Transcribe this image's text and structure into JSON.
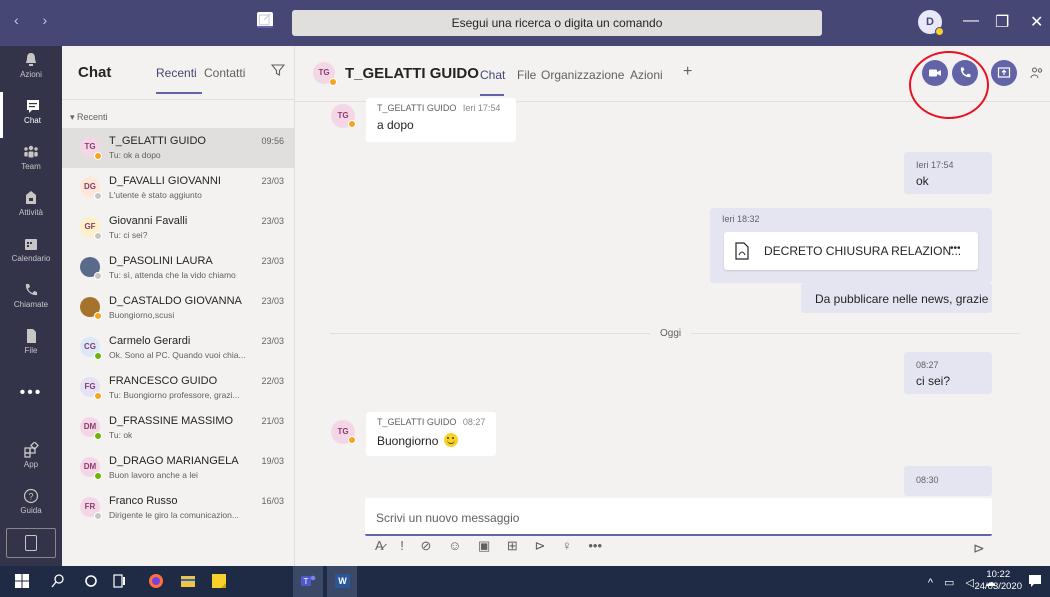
{
  "titlebar": {
    "nav": "‹ ›",
    "search_placeholder": "Esegui una ricerca o digita un comando",
    "profile_initial": "D",
    "minimize": "—",
    "maximize": "❐",
    "close": "✕"
  },
  "rail": [
    {
      "label": "Azioni",
      "icon": "bell-icon"
    },
    {
      "label": "Chat",
      "icon": "chat-icon",
      "active": true
    },
    {
      "label": "Team",
      "icon": "team-icon"
    },
    {
      "label": "Attività",
      "icon": "briefcase-icon"
    },
    {
      "label": "Calendario",
      "icon": "calendar-icon"
    },
    {
      "label": "Chiamate",
      "icon": "phone-icon"
    },
    {
      "label": "File",
      "icon": "file-icon"
    },
    {
      "label": "App",
      "icon": "apps-icon"
    },
    {
      "label": "Guida",
      "icon": "help-icon"
    }
  ],
  "rail_more": "•••",
  "chatlist": {
    "title": "Chat",
    "tab_recent": "Recenti",
    "tab_contacts": "Contatti",
    "section": "▾ Recenti",
    "items": [
      {
        "initials": "TG",
        "name": "T_GELATTI GUIDO",
        "preview": "Tu: ok a dopo",
        "time": "09:56",
        "bg": "#f4d7e6",
        "status": "#f8a51c"
      },
      {
        "initials": "DG",
        "name": "D_FAVALLI GIOVANNI",
        "preview": "L'utente è stato aggiunto",
        "time": "23/03",
        "bg": "#fde7d6",
        "status": "#c8c6c4"
      },
      {
        "initials": "GF",
        "name": "Giovanni Favalli",
        "preview": "Tu: ci sei?",
        "time": "23/03",
        "bg": "#fff0c8",
        "status": "#c8c6c4"
      },
      {
        "initials": "",
        "name": "D_PASOLINI LAURA",
        "preview": "Tu: sì, attenda che la vido chiamo",
        "time": "23/03",
        "bg": "#5a6a8a",
        "status": "#c8c6c4"
      },
      {
        "initials": "",
        "name": "D_CASTALDO GIOVANNA",
        "preview": "Buongiorno,scusi",
        "time": "23/03",
        "bg": "#a5732c",
        "status": "#f8a51c"
      },
      {
        "initials": "CG",
        "name": "Carmelo Gerardi",
        "preview": "Ok. Sono al PC. Quando vuoi chia...",
        "time": "23/03",
        "bg": "#dbe9f7",
        "status": "#6bb700"
      },
      {
        "initials": "FG",
        "name": "FRANCESCO GUIDO",
        "preview": "Tu: Buongiorno professore, grazi...",
        "time": "22/03",
        "bg": "#e4e2f5",
        "status": "#f8a51c"
      },
      {
        "initials": "DM",
        "name": "D_FRASSINE MASSIMO",
        "preview": "Tu: ok",
        "time": "21/03",
        "bg": "#f4d7e6",
        "status": "#6bb700"
      },
      {
        "initials": "DM",
        "name": "D_DRAGO MARIANGELA",
        "preview": "Buon lavoro anche a lei",
        "time": "19/03",
        "bg": "#f4d7e6",
        "status": "#6bb700"
      },
      {
        "initials": "FR",
        "name": "Franco Russo",
        "preview": "Dirigente le giro la comunicazion...",
        "time": "16/03",
        "bg": "#f4d7e6",
        "status": "#c8c6c4"
      }
    ]
  },
  "conversation": {
    "initials": "TG",
    "name": "T_GELATTI GUIDO",
    "tabs": [
      "Chat",
      "File",
      "Organizzazione",
      "Azioni"
    ],
    "add_tab": "+",
    "messages": {
      "m1_author": "T_GELATTI GUIDO",
      "m1_time": "Ieri 17:54",
      "m1_text": "a dopo",
      "m2_time": "Ieri 17:54",
      "m2_text": "ok",
      "m3_time": "Ieri 18:32",
      "m3_file": "DECRETO CHIUSURA RELAZION...",
      "m3_more": "•••",
      "m4_text": "Da pubblicare nelle news, grazie",
      "day": "Oggi",
      "m5_time": "08:27",
      "m5_text": "ci sei?",
      "m6_author": "T_GELATTI GUIDO",
      "m6_time": "08:27",
      "m6_text": "Buongiorno",
      "m7_time": "08:30"
    },
    "compose_placeholder": "Scrivi un nuovo messaggio",
    "compose_tools": [
      "A̷",
      "!",
      "⊘",
      "☺",
      "▣",
      "⊞",
      "⊳",
      "♀",
      "•••"
    ],
    "send": "⊳"
  },
  "taskbar": {
    "tray": "^ ▭ ◁ ☁",
    "time": "10:22",
    "date": "24/03/2020",
    "word_label": "W"
  },
  "colors": {
    "accent": "#6264a7",
    "titlebar": "#464775",
    "rail": "#33344a",
    "annotation": "#e81123"
  }
}
